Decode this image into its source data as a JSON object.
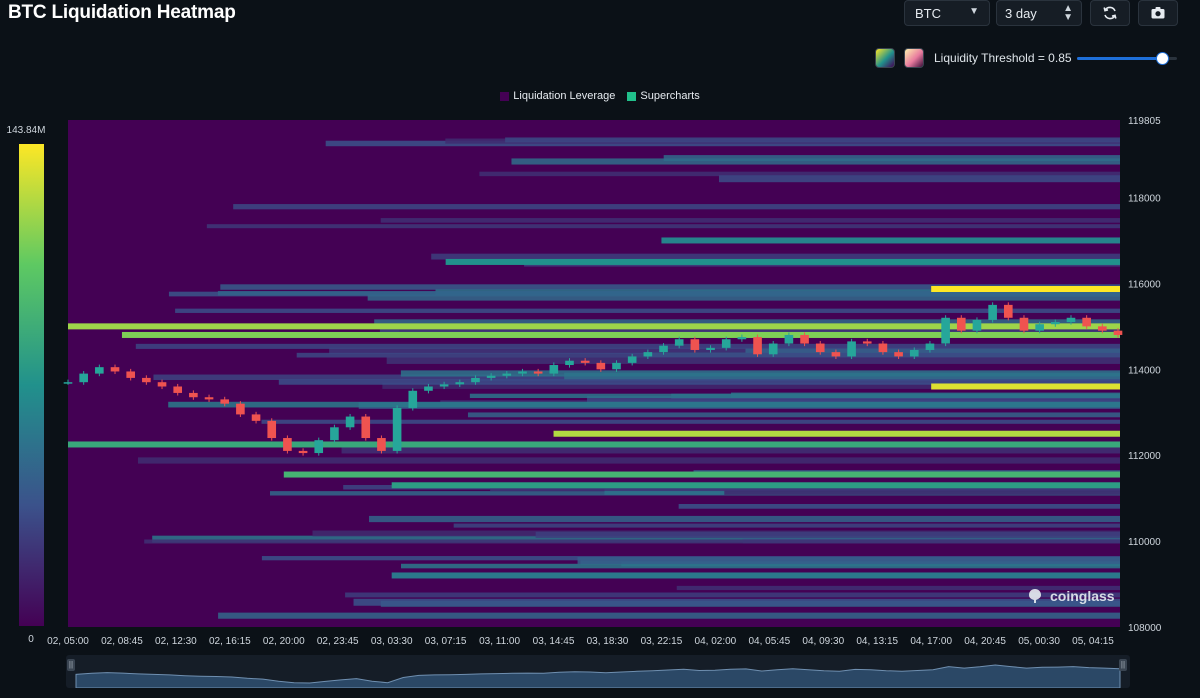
{
  "page_title": "BTC Liquidation Heatmap",
  "controls": {
    "coin_select": "BTC",
    "range_select": "3 day",
    "refresh_icon": "refresh-icon",
    "camera_icon": "camera-icon",
    "threshold_label": "Liquidity Threshold = 0.85",
    "threshold_value": 0.85
  },
  "watermark": "coinglass",
  "colors": {
    "background": "#0b1117",
    "plot_background": "#440154",
    "accent": "#1e6fd9",
    "candle_up": "#26a69a",
    "candle_down": "#ef5350"
  },
  "chart_data": {
    "type": "heatmap",
    "title": "BTC Liquidation Heatmap",
    "legend": [
      {
        "name": "Liquidation Leverage",
        "color": "#440154"
      },
      {
        "name": "Supercharts",
        "color": "#21c08b"
      }
    ],
    "legend_position": "top-center",
    "colorscale": [
      "#440154",
      "#3b528b",
      "#21918c",
      "#5ec962",
      "#fde725"
    ],
    "colorbar": {
      "max_label": "143.84M",
      "min_label": "0"
    },
    "x_ticks": [
      "02, 05:00",
      "02, 08:45",
      "02, 12:30",
      "02, 16:15",
      "02, 20:00",
      "02, 23:45",
      "03, 03:30",
      "03, 07:15",
      "03, 11:00",
      "03, 14:45",
      "03, 18:30",
      "03, 22:15",
      "04, 02:00",
      "04, 05:45",
      "04, 09:30",
      "04, 13:15",
      "04, 17:00",
      "04, 20:45",
      "05, 00:30",
      "05, 04:15"
    ],
    "y_ticks": [
      119805,
      118000,
      116000,
      114000,
      112000,
      110000,
      108000
    ],
    "ylim": [
      108000,
      119805
    ],
    "y_axis_side": "right",
    "price_series": {
      "name": "BTC",
      "x_start": "02, 05:00",
      "x_end": "05, 04:15",
      "values": [
        113700,
        113900,
        114050,
        113950,
        113800,
        113700,
        113600,
        113450,
        113350,
        113300,
        113200,
        112950,
        112800,
        112400,
        112100,
        112050,
        112350,
        112650,
        112900,
        112400,
        112100,
        113100,
        113500,
        113600,
        113650,
        113700,
        113800,
        113850,
        113900,
        113950,
        113900,
        114100,
        114200,
        114150,
        114000,
        114150,
        114300,
        114400,
        114550,
        114700,
        114450,
        114500,
        114700,
        114750,
        114350,
        114600,
        114800,
        114600,
        114400,
        114300,
        114650,
        114600,
        114400,
        114300,
        114450,
        114600,
        115200,
        114900,
        115150,
        115500,
        115200,
        114900,
        115050,
        115100,
        115200,
        115000,
        114900,
        114800
      ]
    },
    "liquidity_bands": [
      {
        "price": 115870,
        "intensity": 1.0,
        "from": "04, 17:00"
      },
      {
        "price": 115000,
        "intensity": 0.85,
        "from": "02, 05:00"
      },
      {
        "price": 114800,
        "intensity": 0.8,
        "from": "02, 08:45"
      },
      {
        "price": 113600,
        "intensity": 0.95,
        "from": "04, 17:00"
      },
      {
        "price": 112500,
        "intensity": 0.88,
        "from": "03, 14:45"
      },
      {
        "price": 112250,
        "intensity": 0.6,
        "from": "02, 05:00"
      },
      {
        "price": 111550,
        "intensity": 0.65,
        "from": "02, 20:00"
      },
      {
        "price": 111300,
        "intensity": 0.55,
        "from": "03, 03:30"
      },
      {
        "price": 116500,
        "intensity": 0.5,
        "from": "03, 07:15"
      },
      {
        "price": 117000,
        "intensity": 0.45,
        "from": "03, 22:15"
      },
      {
        "price": 109200,
        "intensity": 0.4,
        "from": "03, 03:30"
      }
    ]
  }
}
